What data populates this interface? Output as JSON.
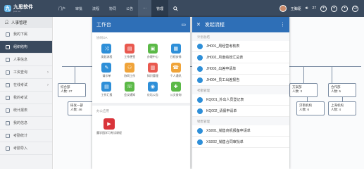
{
  "brand": {
    "name": "九思软件",
    "sub": "jiusi.net"
  },
  "topnav": [
    {
      "label": "门户"
    },
    {
      "label": "审批"
    },
    {
      "label": "流程"
    },
    {
      "label": "协同"
    },
    {
      "label": "公告"
    },
    {
      "label": "···"
    },
    {
      "label": "管理"
    }
  ],
  "user": {
    "name": "王胸驱",
    "count": "27"
  },
  "sidebar": {
    "header": "人事管理",
    "items": [
      {
        "label": "我的下属",
        "expandable": false
      },
      {
        "label": "组织结构",
        "expandable": false
      },
      {
        "label": "人事信息",
        "expandable": false
      },
      {
        "label": "工资查询",
        "expandable": true
      },
      {
        "label": "在线考试",
        "expandable": true
      },
      {
        "label": "我的考试",
        "expandable": false
      },
      {
        "label": "统计报表",
        "expandable": false
      },
      {
        "label": "我的信息",
        "expandable": false
      },
      {
        "label": "考勤统计",
        "expandable": false
      },
      {
        "label": "考勤导入",
        "expandable": false
      }
    ]
  },
  "org": {
    "nodes": [
      {
        "name": "综合部",
        "count": "人数: 27"
      },
      {
        "name": "研发一部",
        "count": "人数: 46"
      },
      {
        "name": "方案部",
        "count": "人数: 3"
      },
      {
        "name": "合作部",
        "count": "人数: 5"
      },
      {
        "name": "济南机构",
        "count": "人数: 6"
      },
      {
        "name": "上海机构",
        "count": "人数: 4"
      }
    ]
  },
  "workbench": {
    "title": "工作台",
    "section_oa": "协同OA",
    "apps": [
      {
        "label": "发起流程",
        "color": "#2e8fd8",
        "glyph": "⤨"
      },
      {
        "label": "工作便签",
        "color": "#e9594f",
        "glyph": "▤"
      },
      {
        "label": "办理中心",
        "color": "#5bb947",
        "glyph": "▣"
      },
      {
        "label": "日程安排",
        "color": "#2e8fd8",
        "glyph": "▦"
      },
      {
        "label": "请示单",
        "color": "#2e8fd8",
        "glyph": "✎"
      },
      {
        "label": "协同工作",
        "color": "#f0a43a",
        "glyph": "⚇"
      },
      {
        "label": "知识管理",
        "color": "#e9594f",
        "glyph": "▥"
      },
      {
        "label": "个人通讯",
        "color": "#f0a43a",
        "glyph": "☎"
      },
      {
        "label": "工作汇报",
        "color": "#2e8fd8",
        "glyph": "▤"
      },
      {
        "label": "会议通知",
        "color": "#5bb947",
        "glyph": "☏"
      },
      {
        "label": "论坛公告",
        "color": "#2e8fd8",
        "glyph": "◉"
      },
      {
        "label": "公文查询",
        "color": "#5bb947",
        "glyph": "✚"
      }
    ],
    "section_office": "办公应用",
    "course_app": {
      "label": "魔学园学习考试课程",
      "color": "#d9343a",
      "glyph": "▶"
    }
  },
  "flows": {
    "title": "发起流程",
    "groups": [
      {
        "title": "计划总结",
        "items": [
          "JH001_周经营考核表",
          "JH002_月度绩效汇总表",
          "JH003_出差申请单",
          "JH004_员工出差报告"
        ]
      },
      {
        "title": "考勤管理",
        "items": [
          "KQ001_外出人员登记表",
          "KQ002_请假申请单"
        ]
      },
      {
        "title": "销售管理",
        "items": [
          "XS001_销售商机报备申请单",
          "XS002_销售合同审批单"
        ]
      }
    ]
  }
}
